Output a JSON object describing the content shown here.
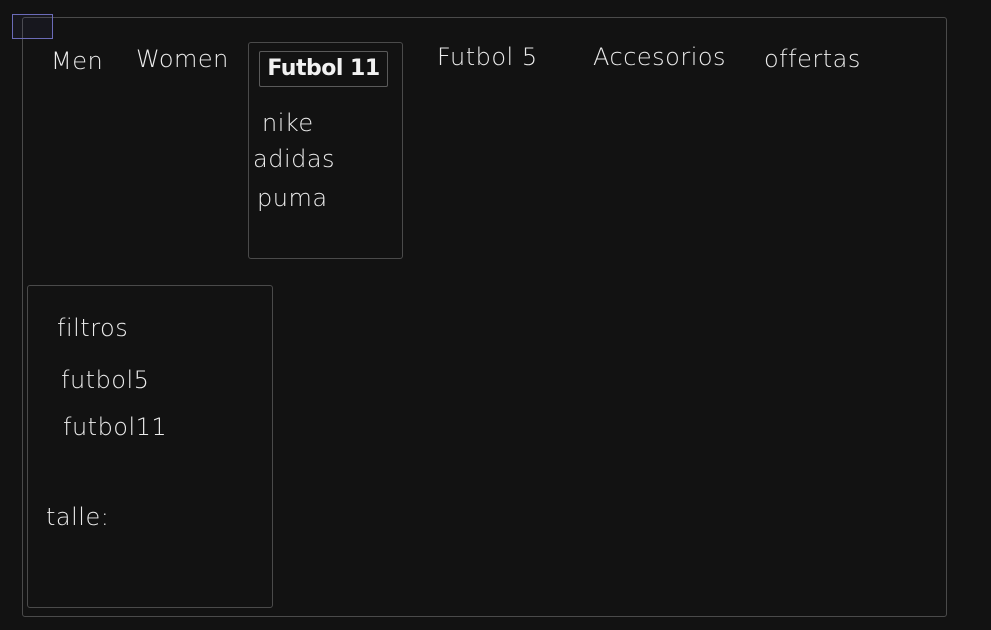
{
  "nav": {
    "men": "Men",
    "women": "Women",
    "futbol5": "Futbol 5",
    "accesorios": "Accesorios",
    "offertas": "offertas"
  },
  "dropdown": {
    "title": "Futbol 11",
    "brands": [
      "nike",
      "adidas",
      "puma"
    ]
  },
  "filters": {
    "heading": "filtros",
    "options": [
      "futbol5",
      "futbol11"
    ],
    "size_label": "talle:"
  },
  "colors": {
    "background": "#121212",
    "stroke": "#4a4a4a",
    "text": "#ececec",
    "selection": "#6b6bb8"
  }
}
